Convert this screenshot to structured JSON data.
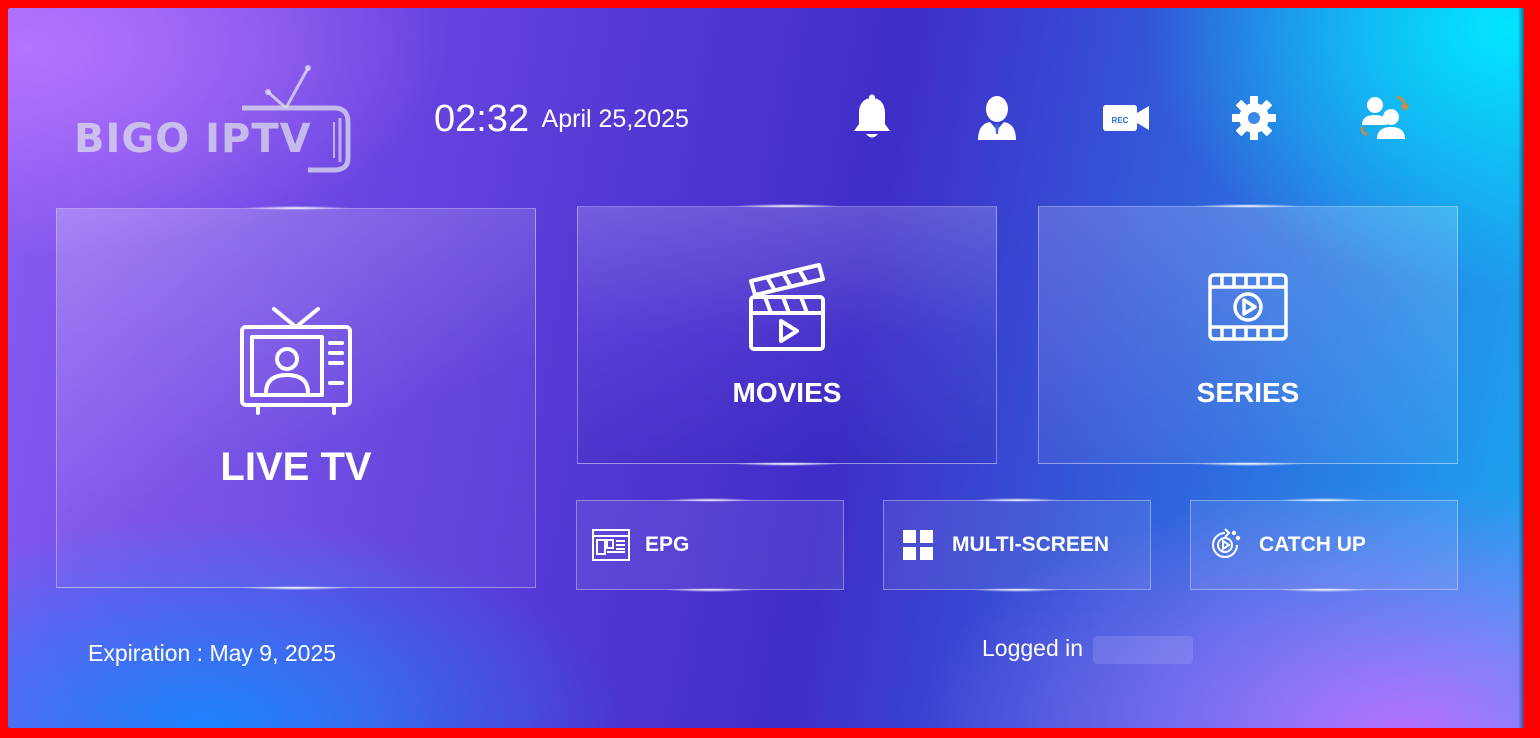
{
  "logo": {
    "text": "BIGO IPTV"
  },
  "clock": {
    "time": "02:32",
    "date": "April 25,2025"
  },
  "top_icons": [
    "bell-icon",
    "user-icon",
    "rec-camera-icon",
    "gear-icon",
    "switch-user-icon"
  ],
  "rec_label": "REC",
  "tiles": {
    "live": "LIVE TV",
    "movies": "MOVIES",
    "series": "SERIES"
  },
  "buttons": {
    "epg": "EPG",
    "multiscreen": "MULTI-SCREEN",
    "catchup": "CATCH UP"
  },
  "footer": {
    "expiration": "Expiration : May 9, 2025",
    "logged_in": "Logged in"
  },
  "colors": {
    "border_frame": "#ff0000",
    "text": "#ffffff"
  }
}
